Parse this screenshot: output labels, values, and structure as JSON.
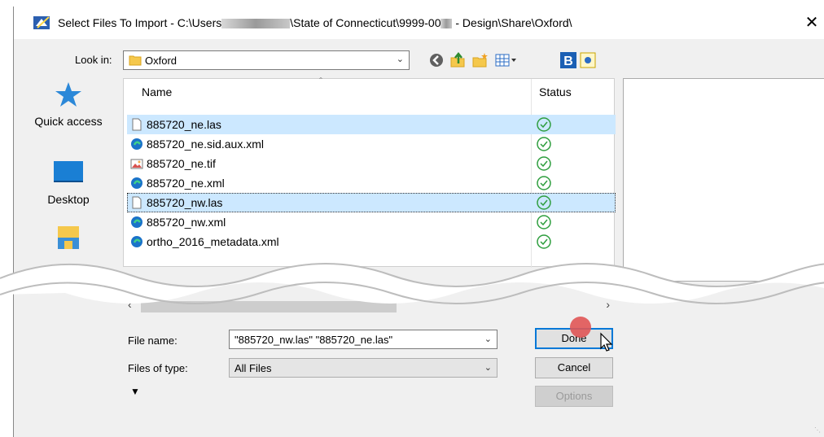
{
  "window": {
    "title_prefix": "Select Files To Import - C:\\Users",
    "title_suffix": "\\State of Connecticut\\9999-00",
    "title_end": " - Design\\Share\\Oxford\\",
    "close_label": "✕"
  },
  "toolbar": {
    "look_in_label": "Look in:",
    "look_in_value": "Oxford"
  },
  "places": [
    {
      "label": "Quick access",
      "icon": "star-icon"
    },
    {
      "label": "Desktop",
      "icon": "desktop-icon"
    },
    {
      "label": "",
      "icon": "folder-icon"
    }
  ],
  "file_list": {
    "columns": [
      "Name",
      "Status"
    ],
    "files": [
      {
        "name": "885720_ne.las",
        "icon": "blank-file-icon",
        "selected": true
      },
      {
        "name": "885720_ne.sid.aux.xml",
        "icon": "edge-icon",
        "selected": false
      },
      {
        "name": "885720_ne.tif",
        "icon": "image-file-icon",
        "selected": false
      },
      {
        "name": "885720_ne.xml",
        "icon": "edge-icon",
        "selected": false
      },
      {
        "name": "885720_nw.las",
        "icon": "blank-file-icon",
        "selected": true
      },
      {
        "name": "885720_nw.xml",
        "icon": "edge-icon",
        "selected": false
      },
      {
        "name": "ortho_2016_metadata.xml",
        "icon": "edge-icon",
        "selected": false
      }
    ]
  },
  "form": {
    "file_name_label": "File name:",
    "file_name_value": "\"885720_nw.las\" \"885720_ne.las\"",
    "files_of_type_label": "Files of type:",
    "files_of_type_value": "All Files"
  },
  "buttons": {
    "done": "Done",
    "cancel": "Cancel",
    "options": "Options"
  },
  "colors": {
    "selection": "#cce8ff",
    "status_green": "#2e9e3e",
    "primary_border": "#0078d7"
  }
}
